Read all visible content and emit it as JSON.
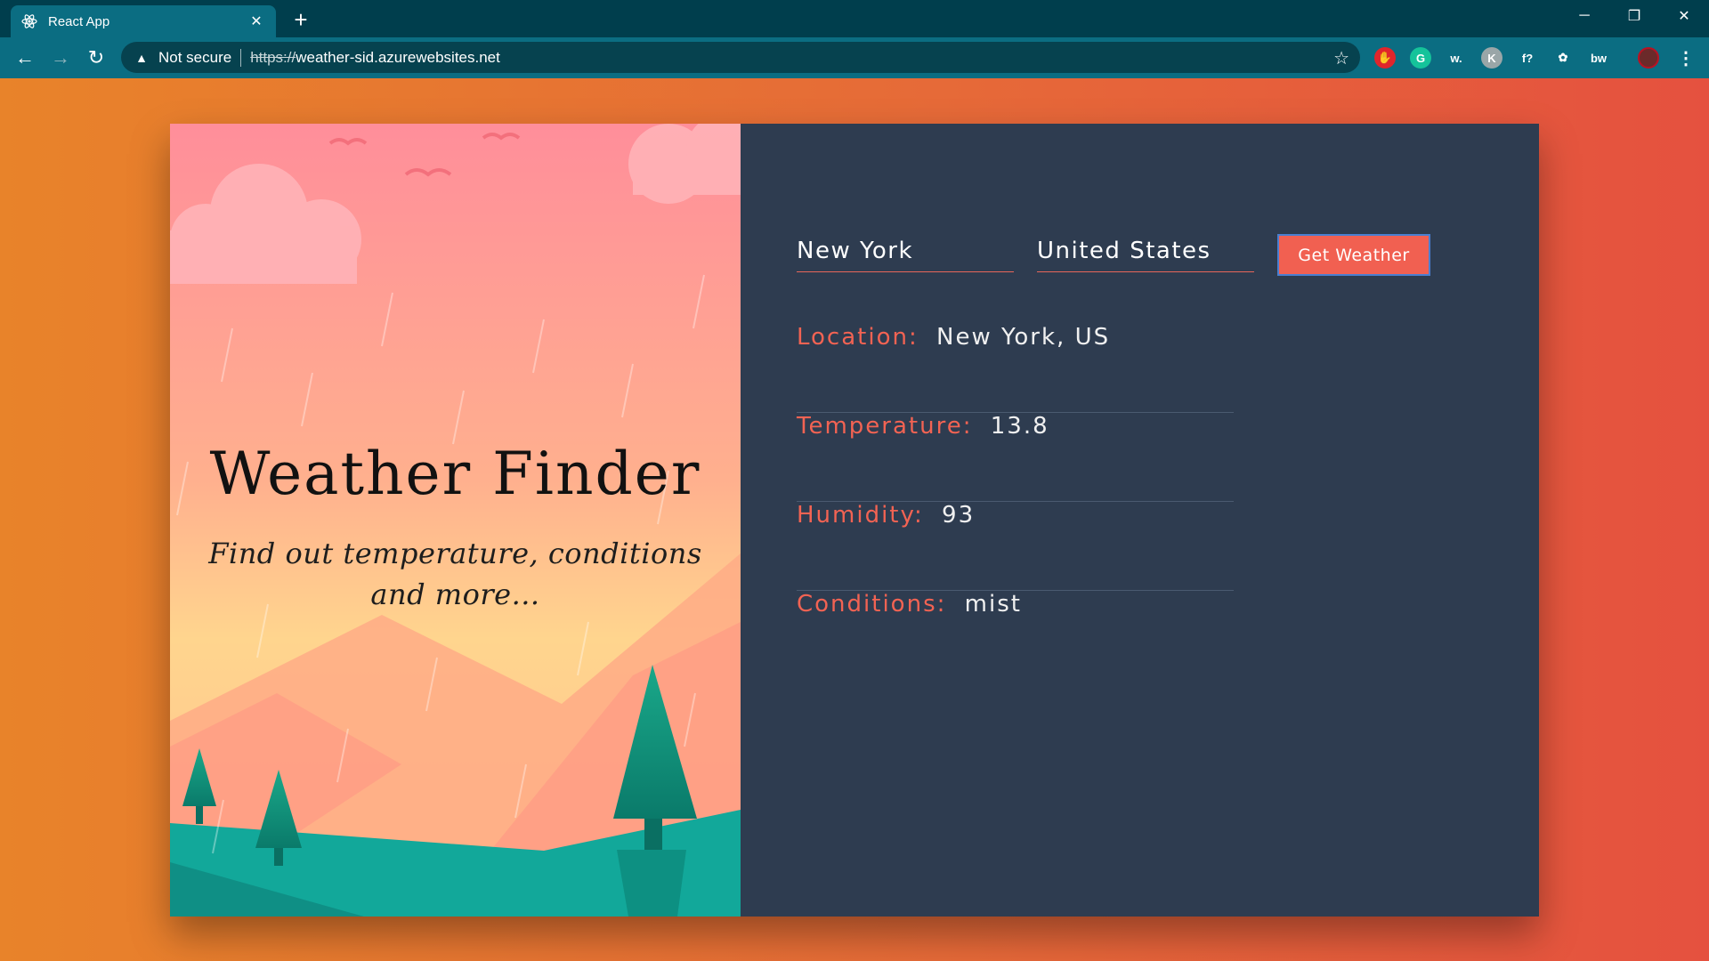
{
  "browser": {
    "tab_title": "React App",
    "security_text": "Not secure",
    "url_scheme": "https://",
    "url_host": "weather-sid.azurewebsites.net"
  },
  "extensions": [
    {
      "name": "adblock-icon",
      "glyph": "✋",
      "color": "#e0252b"
    },
    {
      "name": "grammarly-icon",
      "glyph": "G",
      "color": "#15c39a"
    },
    {
      "name": "wordtune-icon",
      "glyph": "w.",
      "color": "transparent"
    },
    {
      "name": "extension-k-icon",
      "glyph": "K",
      "color": "#9aa6a8"
    },
    {
      "name": "function-icon",
      "glyph": "f?",
      "color": "transparent"
    },
    {
      "name": "color-picker-icon",
      "glyph": "✿",
      "color": "transparent"
    },
    {
      "name": "bw-icon",
      "glyph": "bw",
      "color": "transparent"
    }
  ],
  "hero": {
    "title": "Weather Finder",
    "subtitle": "Find out temperature, conditions and more..."
  },
  "form": {
    "city_value": "New York",
    "country_value": "United States",
    "button_label": "Get Weather"
  },
  "results": [
    {
      "key": "Location:",
      "value": "New York, US"
    },
    {
      "key": "Temperature:",
      "value": "13.8"
    },
    {
      "key": "Humidity:",
      "value": "93"
    },
    {
      "key": "Conditions:",
      "value": "mist"
    }
  ],
  "colors": {
    "accent": "#f26353",
    "panel": "#2e3c50",
    "chrome_dark": "#003e4d",
    "chrome_tab": "#0b6d82"
  }
}
